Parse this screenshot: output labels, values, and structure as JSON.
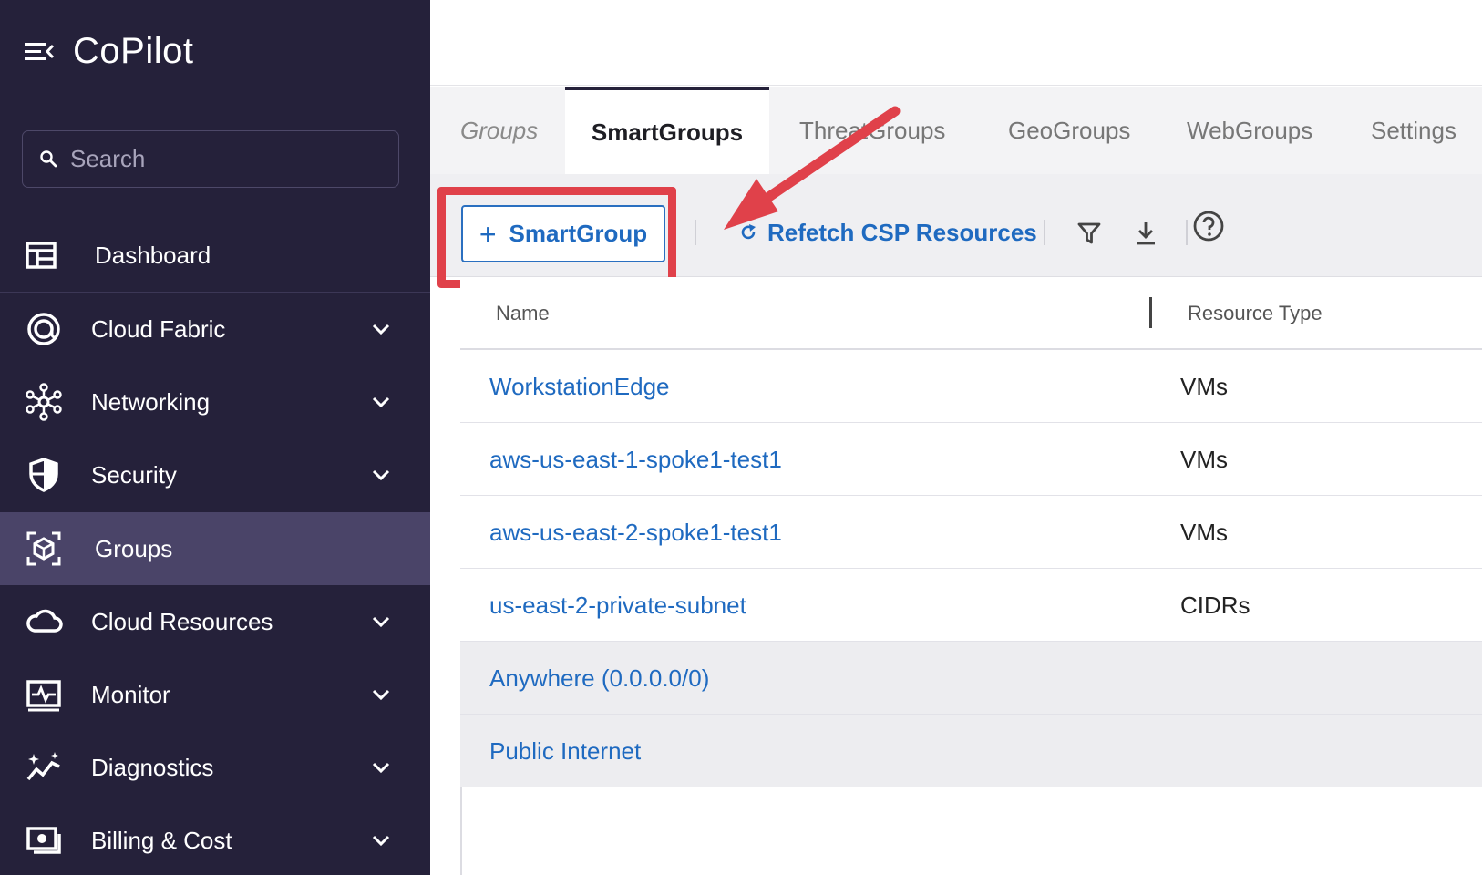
{
  "app": {
    "title": "CoPilot"
  },
  "search": {
    "placeholder": "Search"
  },
  "sidebar": {
    "items": [
      {
        "label": "Dashboard",
        "icon": "dashboard-icon",
        "expandable": false
      },
      {
        "label": "Cloud Fabric",
        "icon": "cloud-fabric-icon",
        "expandable": true
      },
      {
        "label": "Networking",
        "icon": "networking-icon",
        "expandable": true
      },
      {
        "label": "Security",
        "icon": "shield-icon",
        "expandable": true
      },
      {
        "label": "Groups",
        "icon": "groups-icon",
        "expandable": false,
        "active": true
      },
      {
        "label": "Cloud Resources",
        "icon": "cloud-icon",
        "expandable": true
      },
      {
        "label": "Monitor",
        "icon": "monitor-icon",
        "expandable": true
      },
      {
        "label": "Diagnostics",
        "icon": "diagnostics-icon",
        "expandable": true
      },
      {
        "label": "Billing & Cost",
        "icon": "billing-icon",
        "expandable": true
      }
    ]
  },
  "tabs": [
    {
      "label": "Groups"
    },
    {
      "label": "SmartGroups",
      "active": true
    },
    {
      "label": "ThreatGroups"
    },
    {
      "label": "GeoGroups"
    },
    {
      "label": "WebGroups"
    },
    {
      "label": "Settings"
    }
  ],
  "toolbar": {
    "add_label": "SmartGroup",
    "add_plus": "+",
    "refetch_label": "Refetch CSP Resources"
  },
  "table": {
    "columns": [
      "Name",
      "Resource Type"
    ],
    "rows": [
      {
        "name": "WorkstationEdge",
        "type": "VMs"
      },
      {
        "name": "aws-us-east-1-spoke1-test1",
        "type": "VMs"
      },
      {
        "name": "aws-us-east-2-spoke1-test1",
        "type": "VMs"
      },
      {
        "name": "us-east-2-private-subnet",
        "type": "CIDRs"
      },
      {
        "name": "Anywhere (0.0.0.0/0)",
        "type": ""
      },
      {
        "name": "Public Internet",
        "type": ""
      }
    ]
  },
  "colors": {
    "sidebar_bg": "#25213a",
    "sidebar_active": "#4a4468",
    "link_blue": "#1f6ac0",
    "annotation_red": "#e0414a"
  }
}
